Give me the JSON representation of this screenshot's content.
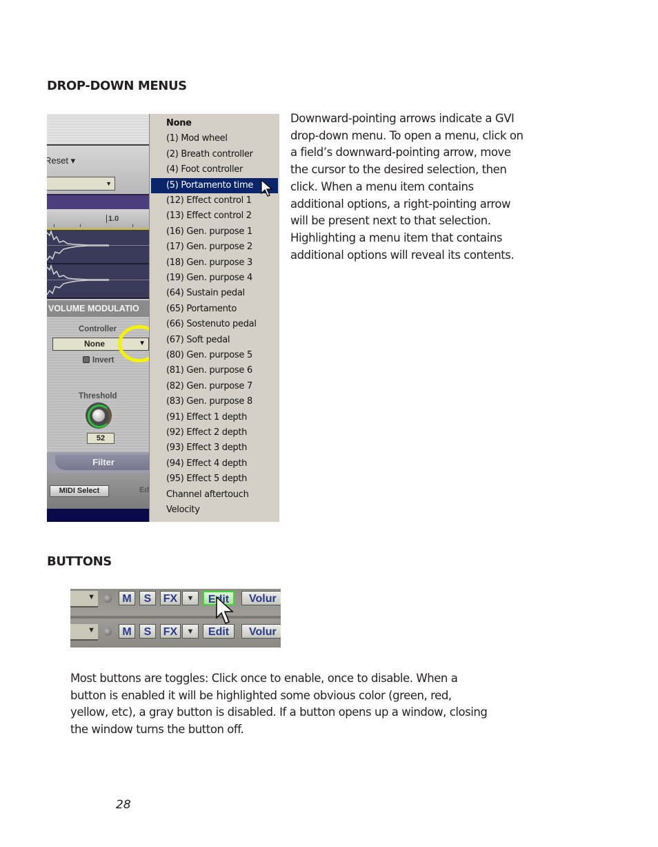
{
  "sections": {
    "dropdown_heading": "DROP-DOWN MENUS",
    "buttons_heading": "BUTTONS"
  },
  "dropdown_description": [
    "Downward-pointing arrows indicate a GVI",
    "drop-down menu. To open a menu, click on",
    "a field’s downward-pointing arrow, move",
    "the cursor to the desired selection, then",
    "click. When a menu item contains",
    "additional options, a right-pointing arrow",
    "will be present next to that selection.",
    "Highlighting a menu item that contains",
    "additional options will reveal its contents."
  ],
  "buttons_description": [
    "Most buttons are toggles: Click once to enable, once to disable. When a",
    "button is enabled it will be highlighted some obvious color (green, red,",
    "yellow, etc), a gray button is disabled. If a button opens up a window, closing",
    "the window turns the button off."
  ],
  "page_number": "28",
  "gvi_panel": {
    "reset_label": "Reset ▾",
    "ruler_mark": "1.0",
    "section_title": "VOLUME MODULATIO",
    "controller_label": "Controller",
    "controller_value": "None",
    "invert_label": "Invert",
    "threshold_label": "Threshold",
    "threshold_value": "52",
    "tab_label": "Filter",
    "midi_select_label": "MIDI Select",
    "edit_partial_label": "Ed",
    "highlight_color": "#f4f10c"
  },
  "controller_menu": {
    "selected_index": 4,
    "selected_color": "#0a246a",
    "items": [
      "None",
      "(1) Mod wheel",
      "(2) Breath controller",
      "(4) Foot controller",
      "(5) Portamento time",
      "(12) Effect control 1",
      "(13) Effect control 2",
      "(16) Gen. purpose 1",
      "(17) Gen. purpose 2",
      "(18) Gen. purpose 3",
      "(19) Gen. purpose 4",
      "(64) Sustain pedal",
      "(65) Portamento",
      "(66) Sostenuto pedal",
      "(67) Soft pedal",
      "(80) Gen. purpose 5",
      "(81) Gen. purpose 6",
      "(82) Gen. purpose 7",
      "(83) Gen. purpose 8",
      "(91) Effect 1 depth",
      "(92) Effect 2 depth",
      "(93) Effect 3 depth",
      "(94) Effect 4 depth",
      "(95) Effect 5 depth",
      "Channel aftertouch",
      "Velocity"
    ]
  },
  "button_rows": [
    {
      "mute": "M",
      "solo": "S",
      "fx": "FX",
      "edit": "Edit",
      "edit_enabled": true,
      "volume": "Volur"
    },
    {
      "mute": "M",
      "solo": "S",
      "fx": "FX",
      "edit": "Edit",
      "edit_enabled": false,
      "volume": "Volur"
    }
  ],
  "enabled_color": "#3cd630"
}
